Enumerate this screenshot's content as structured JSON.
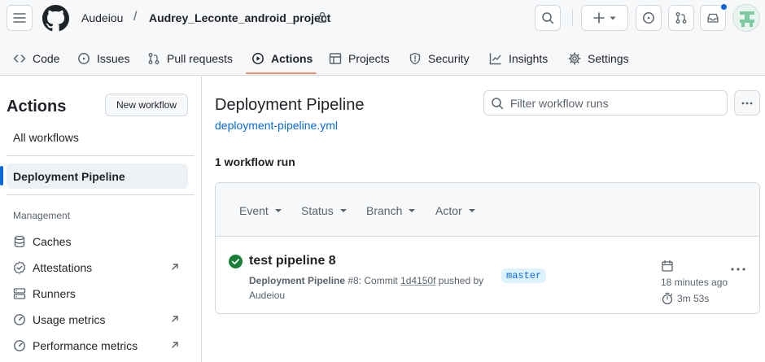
{
  "header": {
    "owner": "Audeiou",
    "separator": "/",
    "repo": "Audrey_Leconte_android_project",
    "colors": {
      "accent": "#0969da",
      "tab_underline": "#fd8c73",
      "success": "#1a7f37"
    }
  },
  "tabs": [
    {
      "label": "Code",
      "icon": "code-icon"
    },
    {
      "label": "Issues",
      "icon": "issue-opened-icon"
    },
    {
      "label": "Pull requests",
      "icon": "git-pull-request-icon"
    },
    {
      "label": "Actions",
      "icon": "play-icon",
      "active": true
    },
    {
      "label": "Projects",
      "icon": "table-icon"
    },
    {
      "label": "Security",
      "icon": "shield-icon"
    },
    {
      "label": "Insights",
      "icon": "graph-icon"
    },
    {
      "label": "Settings",
      "icon": "gear-icon"
    }
  ],
  "sidebar": {
    "title": "Actions",
    "new_workflow": "New workflow",
    "all_workflows": "All workflows",
    "active_workflow": "Deployment Pipeline",
    "management_heading": "Management",
    "management": [
      {
        "label": "Caches",
        "icon": "database-icon",
        "external": false
      },
      {
        "label": "Attestations",
        "icon": "verified-icon",
        "external": true
      },
      {
        "label": "Runners",
        "icon": "server-icon",
        "external": false
      },
      {
        "label": "Usage metrics",
        "icon": "meter-icon",
        "external": true
      },
      {
        "label": "Performance metrics",
        "icon": "meter-icon",
        "external": true
      }
    ]
  },
  "main": {
    "title": "Deployment Pipeline",
    "file": "deployment-pipeline.yml",
    "filter_placeholder": "Filter workflow runs",
    "run_count": "1 workflow run",
    "filters": [
      "Event",
      "Status",
      "Branch",
      "Actor"
    ],
    "run": {
      "title": "test pipeline 8",
      "workflow": "Deployment Pipeline",
      "meta_mid": " #8: Commit ",
      "sha": "1d4150f",
      "meta_end": " pushed by",
      "actor": "Audeiou",
      "branch": "master",
      "time_ago": "18 minutes ago",
      "duration": "3m 53s"
    }
  }
}
